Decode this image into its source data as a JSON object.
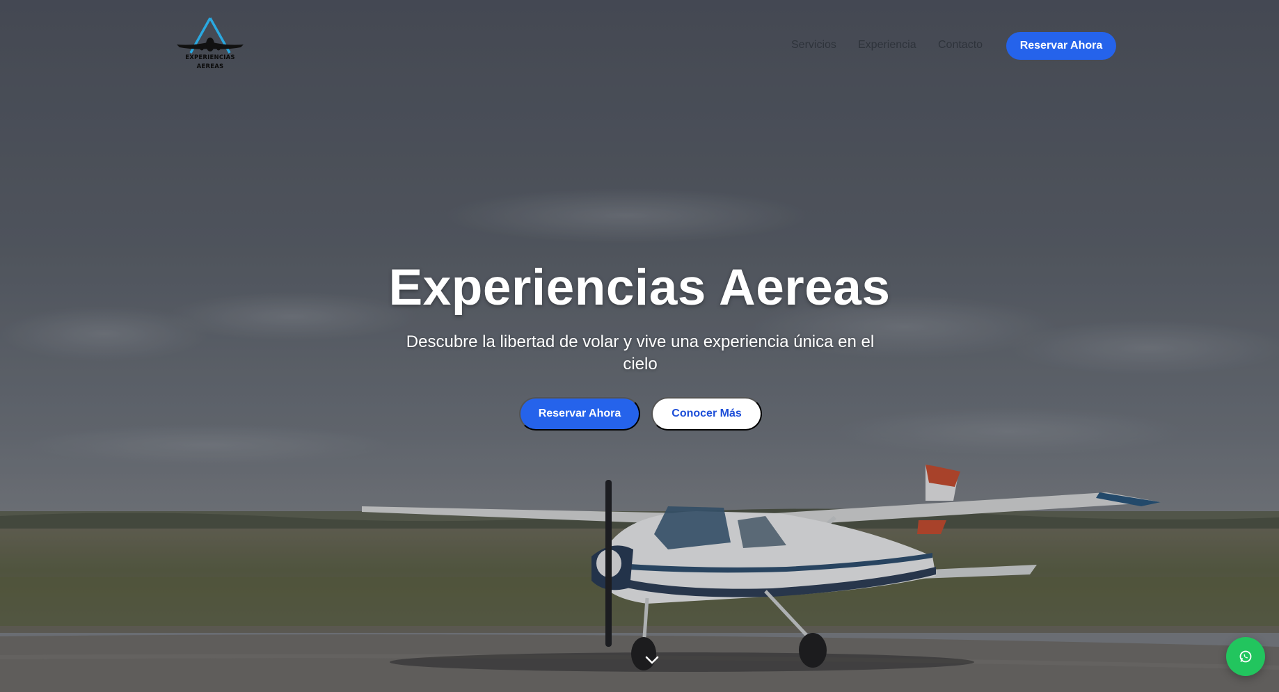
{
  "header": {
    "logo": {
      "line1": "EXPERIENCIAS",
      "line2": "AEREAS"
    },
    "nav": {
      "items": [
        {
          "label": "Servicios"
        },
        {
          "label": "Experiencia"
        },
        {
          "label": "Contacto"
        }
      ],
      "cta_label": "Reservar Ahora"
    }
  },
  "hero": {
    "title": "Experiencias Aereas",
    "subtitle": "Descubre la libertad de volar y vive una experiencia única en el cielo",
    "primary_button": "Reservar Ahora",
    "secondary_button": "Conocer Más",
    "scroll_icon": "chevron-down-icon"
  },
  "floating": {
    "whatsapp_icon": "whatsapp-icon"
  },
  "colors": {
    "primary": "#2563eb",
    "whatsapp": "#22c55e",
    "logo_accent": "#2aa8e0"
  }
}
